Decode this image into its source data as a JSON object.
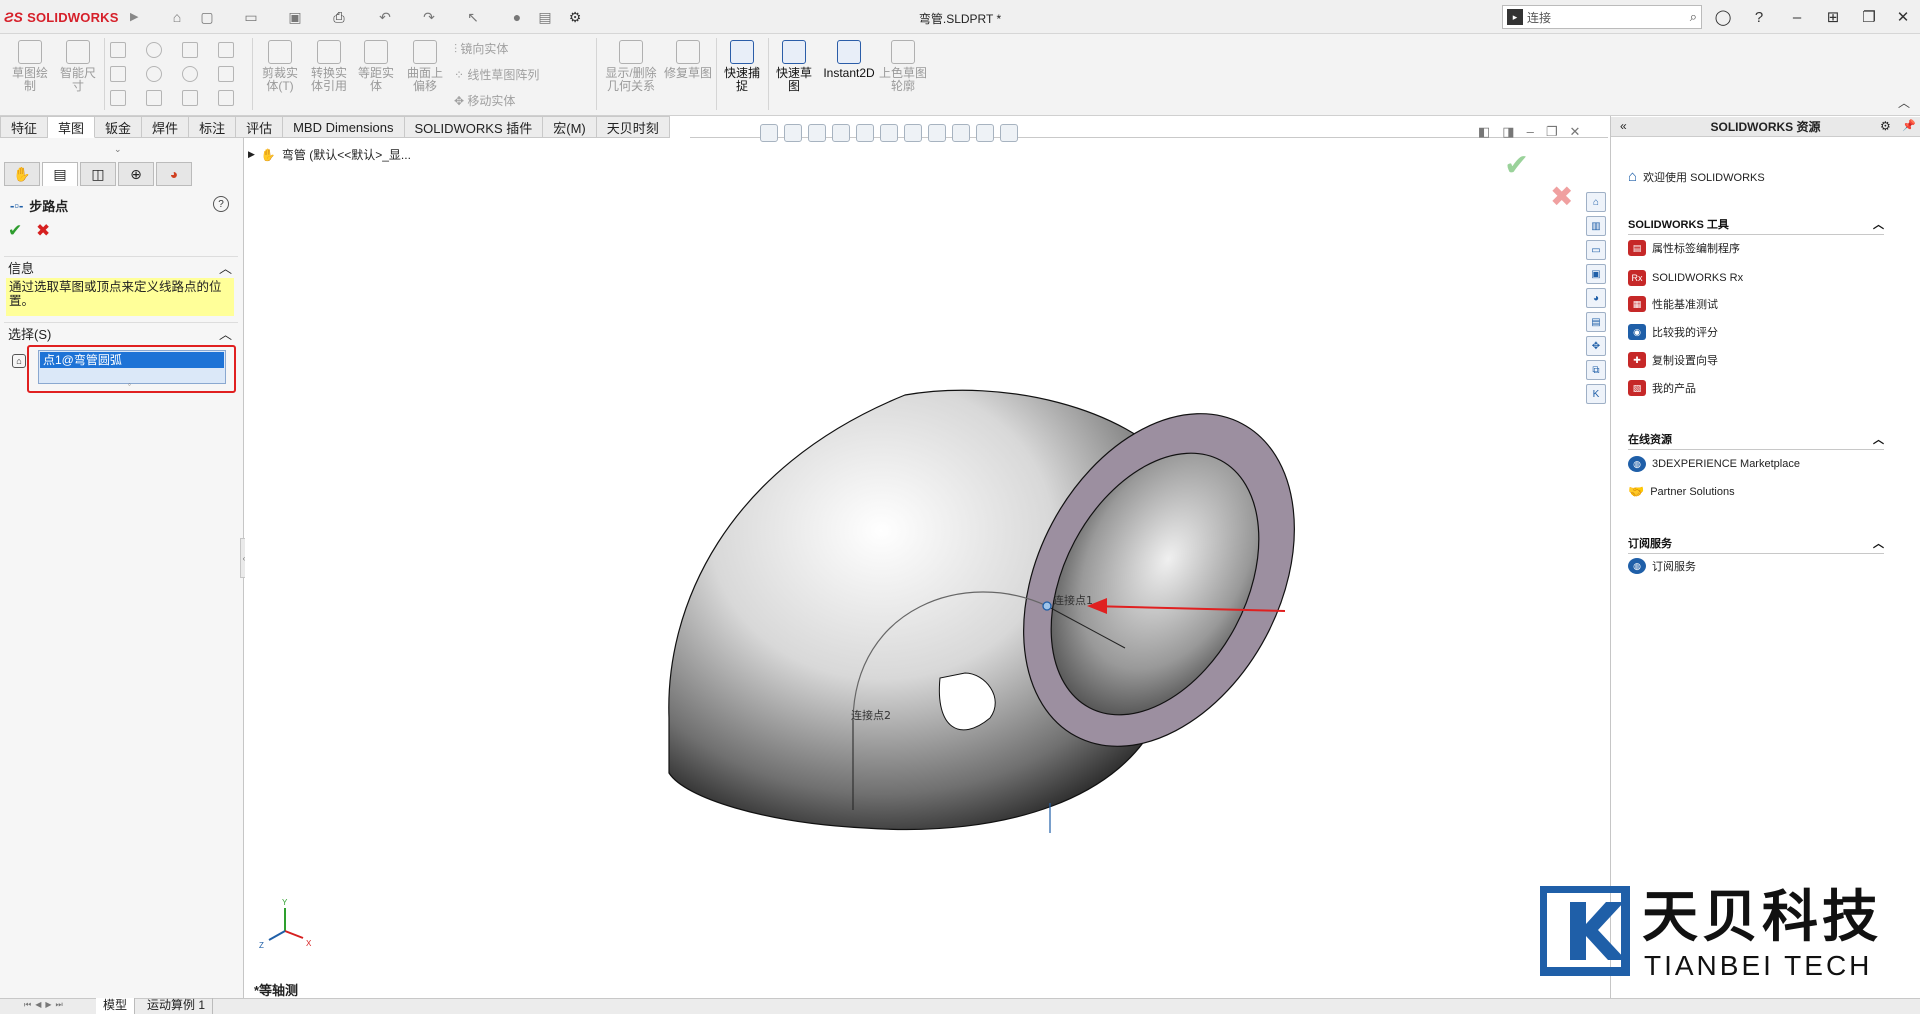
{
  "app": {
    "brand": "SOLIDWORKS",
    "doc_title": "弯管.SLDPRT *"
  },
  "search": {
    "placeholder": "连接"
  },
  "ribbon": {
    "buttons": [
      "草图绘制",
      "智能尺寸",
      "剪裁实体(T)",
      "转换实体引用",
      "等距实体",
      "曲面上偏移",
      "显示/删除几何关系",
      "修复草图",
      "快速捕捉",
      "快速草图",
      "Instant2D",
      "上色草图轮廓"
    ],
    "mirror": "镜向实体",
    "linear_pattern": "线性草图阵列",
    "move": "移动实体"
  },
  "tabs": [
    "特征",
    "草图",
    "钣金",
    "焊件",
    "标注",
    "评估",
    "MBD Dimensions",
    "SOLIDWORKS 插件",
    "宏(M)",
    "天贝时刻"
  ],
  "panel": {
    "title": "步路点",
    "info_header": "信息",
    "info_text": "通过选取草图或顶点来定义线路点的位置。",
    "selection_header": "选择(S)",
    "selection_item": "点1@弯管圆弧"
  },
  "viewport": {
    "tree_label": "弯管 (默认<<默认>_显...",
    "label_point1": "连接点1",
    "label_point2": "连接点2",
    "view_name": "*等轴测",
    "axis_x": "X",
    "axis_y": "Y",
    "axis_z": "Z"
  },
  "resources": {
    "title": "SOLIDWORKS 资源",
    "welcome": "欢迎使用 SOLIDWORKS",
    "tools_header": "SOLIDWORKS 工具",
    "tools": [
      "属性标签编制程序",
      "SOLIDWORKS Rx",
      "性能基准测试",
      "比较我的评分",
      "复制设置向导",
      "我的产品"
    ],
    "online_header": "在线资源",
    "online": [
      "3DEXPERIENCE Marketplace",
      "Partner Solutions"
    ],
    "sub_header": "订阅服务",
    "sub": [
      "订阅服务"
    ]
  },
  "status_tabs": [
    "模型",
    "运动算例 1"
  ],
  "watermark": {
    "cn": "天贝科技",
    "en": "TIANBEI TECH"
  },
  "colors": {
    "accent": "#1e73d6",
    "highlight": "#e02020",
    "brand_red": "#d6202a",
    "info_bg": "#ffff99"
  }
}
